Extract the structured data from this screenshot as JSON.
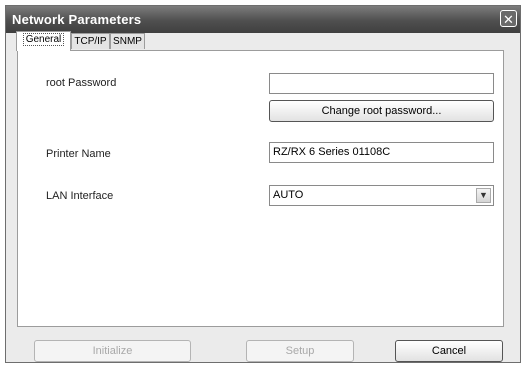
{
  "window": {
    "title": "Network Parameters",
    "close_icon": "close-icon"
  },
  "tabs": [
    {
      "label": "General",
      "active": true
    },
    {
      "label": "TCP/IP",
      "active": false
    },
    {
      "label": "SNMP",
      "active": false
    }
  ],
  "general": {
    "root_password_label": "root Password",
    "root_password_value": "",
    "change_password_button": "Change root password...",
    "printer_name_label": "Printer Name",
    "printer_name_value": "RZ/RX 6 Series 01108C",
    "lan_interface_label": "LAN Interface",
    "lan_interface_value": "AUTO"
  },
  "footer": {
    "initialize_button": "Initialize",
    "setup_button": "Setup",
    "cancel_button": "Cancel"
  }
}
